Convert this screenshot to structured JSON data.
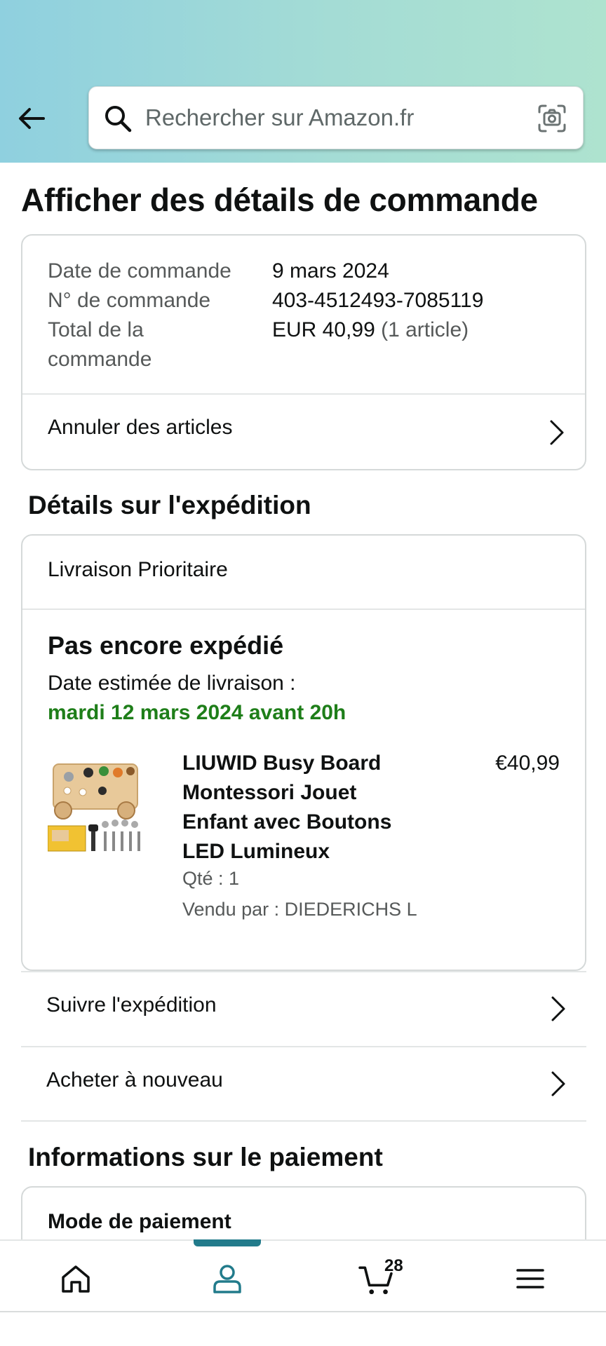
{
  "search": {
    "placeholder": "Rechercher sur Amazon.fr"
  },
  "page": {
    "title": "Afficher des détails de commande"
  },
  "order": {
    "date_label": "Date de commande",
    "date_value": "9 mars 2024",
    "number_label": "N° de commande",
    "number_value": "403-4512493-7085119",
    "total_label_line1": "Total de la",
    "total_label_line2": "commande",
    "total_value": "EUR 40,99",
    "total_count": "(1 article)",
    "cancel_label": "Annuler des articles"
  },
  "shipping": {
    "section_title": "Détails sur l'expédition",
    "type": "Livraison Prioritaire",
    "status": "Pas encore expédié",
    "estimate_label": "Date estimée de livraison :",
    "estimate_date": "mardi 12 mars 2024 avant 20h",
    "product": {
      "title": "LIUWID Busy Board Montessori Jouet Enfant avec Boutons LED Lumineux",
      "price": "€40,99",
      "qty": "Qté : 1",
      "seller": "Vendu par : DIEDERICHS L"
    },
    "track_label": "Suivre l'expédition",
    "buy_again_label": "Acheter à nouveau"
  },
  "payment": {
    "section_title": "Informations sur le paiement",
    "method_title": "Mode de paiement"
  },
  "nav": {
    "cart_count": "28"
  },
  "colors": {
    "accent": "#227b8b",
    "delivery_green": "#1e7e19"
  }
}
